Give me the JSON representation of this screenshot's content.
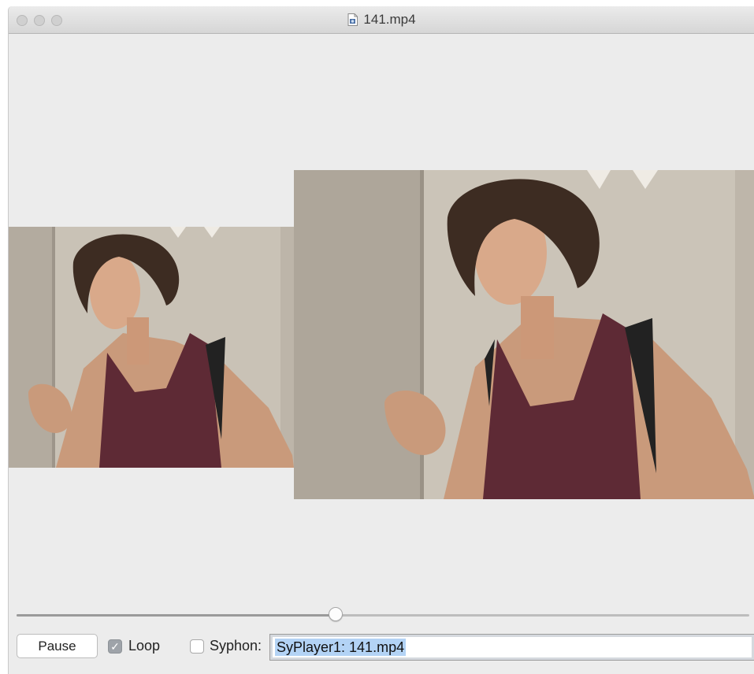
{
  "window": {
    "title": "141.mp4",
    "file_icon": "video-document-icon"
  },
  "video": {
    "small_preview_icon": "video-frame",
    "large_preview_icon": "video-frame"
  },
  "playback": {
    "progress": 0.435
  },
  "controls": {
    "pause_label": "Pause",
    "loop_label": "Loop",
    "loop_checked": true,
    "syphon_label": "Syphon:",
    "syphon_checked": false,
    "syphon_name_value": "SyPlayer1: 141.mp4"
  },
  "colors": {
    "selection": "#b3d3f5",
    "tank_top": "#5e2a35",
    "wall": "#cfc8bd"
  }
}
